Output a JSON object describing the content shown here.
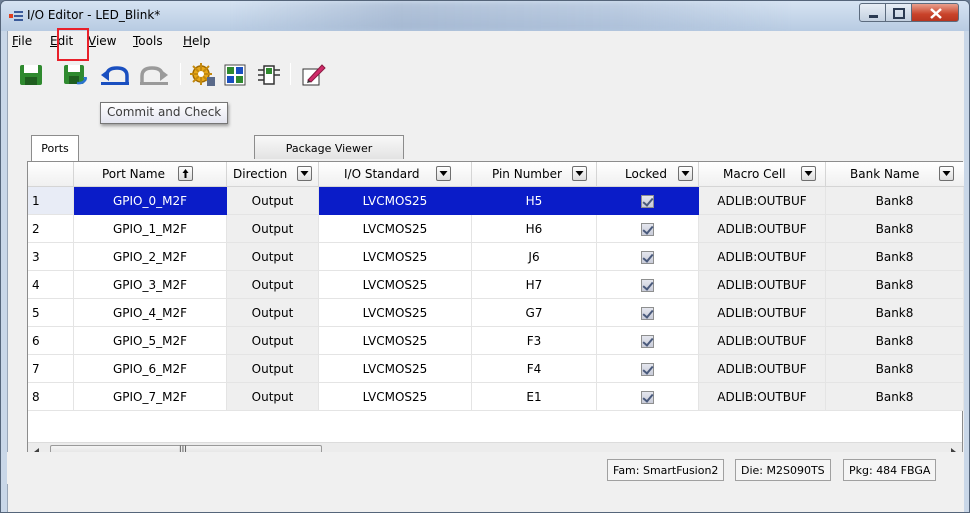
{
  "window": {
    "title": "I/O Editor - LED_Blink*"
  },
  "menu": [
    {
      "label": "File",
      "u": "F",
      "rest": "ile"
    },
    {
      "label": "Edit",
      "u": "E",
      "rest": "dit"
    },
    {
      "label": "View",
      "u": "V",
      "rest": "iew"
    },
    {
      "label": "Tools",
      "u": "T",
      "rest": "ools"
    },
    {
      "label": "Help",
      "u": "H",
      "rest": "elp"
    }
  ],
  "toolbar": {
    "tooltip": "Commit and Check",
    "buttons": [
      "save-icon",
      "commit-and-check-icon",
      "undo-icon",
      "redo-icon",
      "settings-gear-icon",
      "pin-assign-icon",
      "block-icon",
      "edit-icon"
    ]
  },
  "tabs": [
    {
      "label": "Ports",
      "active": true
    },
    {
      "label": "Package Viewer",
      "active": false
    }
  ],
  "grid": {
    "columns": [
      "Port Name",
      "Direction",
      "I/O Standard",
      "Pin Number",
      "Locked",
      "Macro Cell",
      "Bank Name"
    ],
    "rows": [
      {
        "num": "1",
        "port": "GPIO_0_M2F",
        "dir": "Output",
        "std": "LVCMOS25",
        "pin": "H5",
        "macro": "ADLIB:OUTBUF",
        "bank": "Bank8"
      },
      {
        "num": "2",
        "port": "GPIO_1_M2F",
        "dir": "Output",
        "std": "LVCMOS25",
        "pin": "H6",
        "macro": "ADLIB:OUTBUF",
        "bank": "Bank8"
      },
      {
        "num": "3",
        "port": "GPIO_2_M2F",
        "dir": "Output",
        "std": "LVCMOS25",
        "pin": "J6",
        "macro": "ADLIB:OUTBUF",
        "bank": "Bank8"
      },
      {
        "num": "4",
        "port": "GPIO_3_M2F",
        "dir": "Output",
        "std": "LVCMOS25",
        "pin": "H7",
        "macro": "ADLIB:OUTBUF",
        "bank": "Bank8"
      },
      {
        "num": "5",
        "port": "GPIO_4_M2F",
        "dir": "Output",
        "std": "LVCMOS25",
        "pin": "G7",
        "macro": "ADLIB:OUTBUF",
        "bank": "Bank8"
      },
      {
        "num": "6",
        "port": "GPIO_5_M2F",
        "dir": "Output",
        "std": "LVCMOS25",
        "pin": "F3",
        "macro": "ADLIB:OUTBUF",
        "bank": "Bank8"
      },
      {
        "num": "7",
        "port": "GPIO_6_M2F",
        "dir": "Output",
        "std": "LVCMOS25",
        "pin": "F4",
        "macro": "ADLIB:OUTBUF",
        "bank": "Bank8"
      },
      {
        "num": "8",
        "port": "GPIO_7_M2F",
        "dir": "Output",
        "std": "LVCMOS25",
        "pin": "E1",
        "macro": "ADLIB:OUTBUF",
        "bank": "Bank8"
      }
    ],
    "scrollbar_glyph": "III"
  },
  "status": {
    "fam": "Fam: SmartFusion2",
    "die": "Die: M2S090TS",
    "pkg": "Pkg: 484 FBGA"
  },
  "colors": {
    "selection": "#0a1cc8",
    "highlight_box": "#e8202a",
    "title_bar": "#c9d7e8"
  }
}
